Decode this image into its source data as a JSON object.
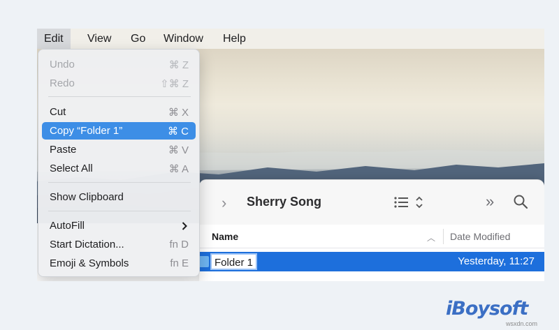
{
  "menubar": {
    "items": [
      {
        "label": "Edit"
      },
      {
        "label": "View"
      },
      {
        "label": "Go"
      },
      {
        "label": "Window"
      },
      {
        "label": "Help"
      }
    ]
  },
  "edit_menu": {
    "undo": {
      "label": "Undo",
      "shortcut": "⌘ Z"
    },
    "redo": {
      "label": "Redo",
      "shortcut": "⇧⌘ Z"
    },
    "cut": {
      "label": "Cut",
      "shortcut": "⌘ X"
    },
    "copy": {
      "label": "Copy “Folder 1”",
      "shortcut": "⌘ C"
    },
    "paste": {
      "label": "Paste",
      "shortcut": "⌘ V"
    },
    "select_all": {
      "label": "Select All",
      "shortcut": "⌘ A"
    },
    "show_clipboard": {
      "label": "Show Clipboard"
    },
    "autofill": {
      "label": "AutoFill"
    },
    "start_dictation": {
      "label": "Start Dictation...",
      "shortcut": "fn D"
    },
    "emoji_symbols": {
      "label": "Emoji & Symbols",
      "shortcut": "fn E"
    }
  },
  "finder": {
    "title": "Sherry Song",
    "columns": {
      "name": "Name",
      "date_modified": "Date Modified"
    },
    "rows": [
      {
        "name": "Folder 1",
        "date": "Yesterday, 11:27"
      }
    ]
  },
  "watermark": {
    "brand": "iBoysoft",
    "url": "wsxdn.com"
  },
  "colors": {
    "highlight": "#3d8ee6",
    "selection_row": "#1d6fdc",
    "brand": "#3b6fc4"
  }
}
